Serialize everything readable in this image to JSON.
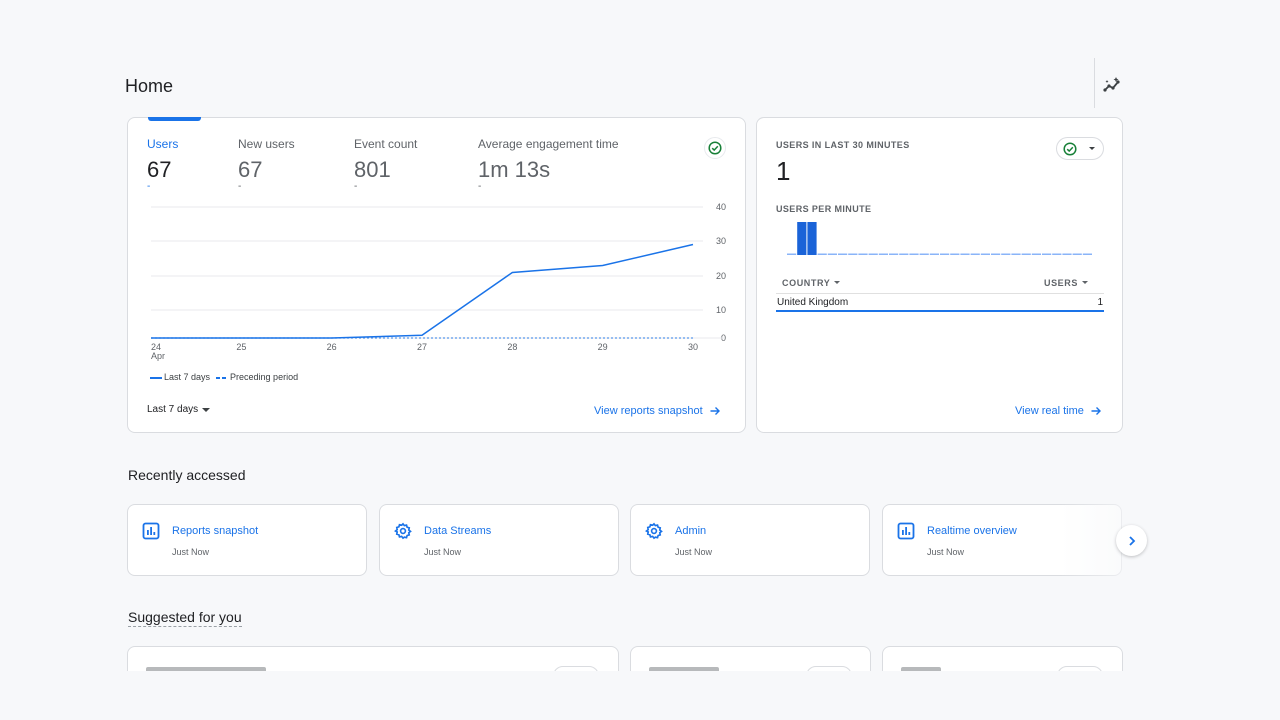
{
  "page": {
    "title": "Home"
  },
  "summary_card": {
    "metrics": [
      {
        "label": "Users",
        "value": "67",
        "change": "-",
        "active": true
      },
      {
        "label": "New users",
        "value": "67",
        "change": "-",
        "active": false
      },
      {
        "label": "Event count",
        "value": "801",
        "change": "-",
        "active": false
      },
      {
        "label": "Average engagement time",
        "value": "1m 13s",
        "change": "-",
        "active": false
      }
    ],
    "legend": {
      "current": "Last 7 days",
      "previous": "Preceding period"
    },
    "date_range": "Last 7 days",
    "link": "View reports snapshot",
    "status_icon": "check-circle-icon"
  },
  "chart_data": [
    {
      "type": "line",
      "title": "Users",
      "x": [
        "24",
        "25",
        "26",
        "27",
        "28",
        "29",
        "30"
      ],
      "x_sublabel": {
        "24": "Apr"
      },
      "series": [
        {
          "name": "Last 7 days",
          "style": "solid",
          "values": [
            0,
            0,
            0,
            1,
            21,
            23,
            29
          ]
        },
        {
          "name": "Preceding period",
          "style": "dashed",
          "values": [
            0,
            0,
            0,
            0,
            0,
            0,
            0
          ]
        }
      ],
      "y_ticks": [
        0,
        10,
        20,
        30,
        40
      ],
      "ylim": [
        0,
        40
      ],
      "y_axis_side": "right",
      "grid": true,
      "legend": "bottom-left",
      "color": "#1a73e8"
    },
    {
      "type": "bar",
      "title": "Users per minute",
      "categories_count": 30,
      "values": [
        0,
        1,
        1,
        0,
        0,
        0,
        0,
        0,
        0,
        0,
        0,
        0,
        0,
        0,
        0,
        0,
        0,
        0,
        0,
        0,
        0,
        0,
        0,
        0,
        0,
        0,
        0,
        0,
        0,
        0
      ],
      "ylim": [
        0,
        1
      ],
      "color": "#1a73e8"
    }
  ],
  "realtime_card": {
    "title": "USERS IN LAST 30 MINUTES",
    "value": "1",
    "subtitle": "USERS PER MINUTE",
    "table": {
      "columns": [
        "COUNTRY",
        "USERS"
      ],
      "rows": [
        {
          "country": "United Kingdom",
          "users": "1"
        }
      ]
    },
    "link": "View real time"
  },
  "recently_accessed": {
    "title": "Recently accessed",
    "items": [
      {
        "label": "Reports snapshot",
        "time": "Just Now",
        "icon": "bar-chart-icon"
      },
      {
        "label": "Data Streams",
        "time": "Just Now",
        "icon": "gear-icon"
      },
      {
        "label": "Admin",
        "time": "Just Now",
        "icon": "gear-icon"
      },
      {
        "label": "Realtime overview",
        "time": "Just Now",
        "icon": "bar-chart-icon"
      }
    ]
  },
  "suggested": {
    "title": "Suggested for you"
  },
  "colors": {
    "accent": "#1a73e8",
    "success": "#188038",
    "background": "#f7f8fa"
  }
}
